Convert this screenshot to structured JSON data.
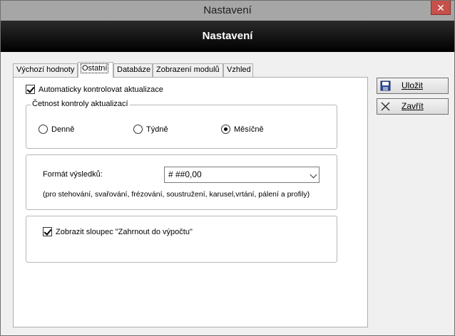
{
  "window": {
    "title": "Nastavení",
    "close_symbol": "✕"
  },
  "header": {
    "title": "Nastavení"
  },
  "tabs": [
    {
      "label": "Výchozí hodnoty",
      "active": false
    },
    {
      "label": "Ostatní",
      "active": true
    },
    {
      "label": "Databáze",
      "active": false
    },
    {
      "label": "Zobrazení modulů",
      "active": false
    },
    {
      "label": "Vzhled",
      "active": false
    }
  ],
  "ostatni": {
    "auto_update": {
      "label": "Automaticky kontrolovat aktualizace",
      "checked": true
    },
    "frequency_group": {
      "legend": "Četnost kontroly aktualizací",
      "options": [
        {
          "label": "Denně",
          "checked": false
        },
        {
          "label": "Týdně",
          "checked": false
        },
        {
          "label": "Měsíčně",
          "checked": true
        }
      ]
    },
    "format": {
      "label": "Formát výsledků:",
      "value": "# ##0,00",
      "note": "(pro stehování, svařování, frézování, soustružení, karusel,vrtání, pálení a profily)"
    },
    "show_column": {
      "label": "Zobrazit sloupec \"Zahrnout do výpočtu\"",
      "checked": true
    }
  },
  "buttons": {
    "save": {
      "label": "Uložit",
      "icon": "floppy-disk-icon"
    },
    "close": {
      "label": "Zavřít",
      "icon": "close-x-icon"
    }
  }
}
